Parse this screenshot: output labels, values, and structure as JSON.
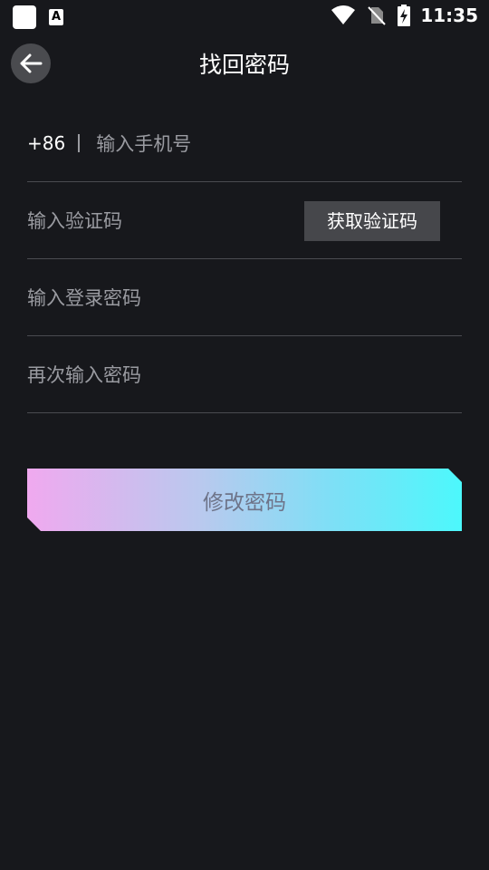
{
  "status_bar": {
    "time": "11:35",
    "a_icon_letter": "A"
  },
  "header": {
    "title": "找回密码"
  },
  "form": {
    "country_code": "+86",
    "phone_placeholder": "输入手机号",
    "code_placeholder": "输入验证码",
    "get_code_label": "获取验证码",
    "password_placeholder": "输入登录密码",
    "confirm_placeholder": "再次输入密码"
  },
  "submit": {
    "label": "修改密码"
  },
  "colors": {
    "background": "#17181c",
    "gradient_start": "#f0a9ef",
    "gradient_end": "#4cf8fc",
    "placeholder": "#9a9ba1",
    "divider": "#4a4b50",
    "get_code_bg": "#46474b"
  },
  "icons": [
    "app-square-icon",
    "a-icon",
    "wifi-icon",
    "no-sim-icon",
    "battery-charging-icon",
    "back-arrow-icon"
  ]
}
